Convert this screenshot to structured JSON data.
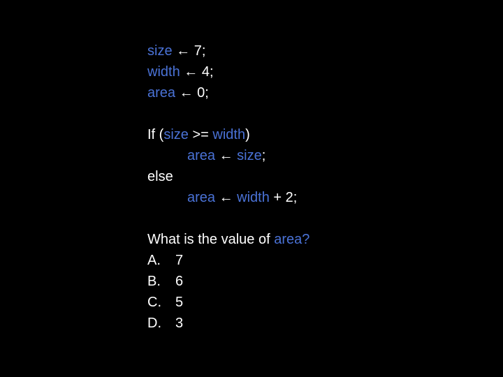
{
  "slide": {
    "colors": {
      "background": "#000000",
      "text": "#ffffff",
      "variable": "#4a72d6"
    },
    "arrow": "←",
    "code": {
      "line1": {
        "var": "size",
        "rest": " 7;"
      },
      "line2": {
        "var": "width",
        "rest": " 4;"
      },
      "line3": {
        "var": "area",
        "rest": " 0;"
      },
      "if_line": {
        "keyword": "If (",
        "var1": "size",
        "op": " >= ",
        "var2": "width",
        "close": ")"
      },
      "then_line": {
        "var1": "area",
        "var2": "size",
        "end": ";"
      },
      "else_keyword": "else",
      "else_line": {
        "var1": "area",
        "var2": "width",
        "rest": " + 2;"
      }
    },
    "question": {
      "text": "What is the value of ",
      "highlight": "area?"
    },
    "options": [
      {
        "letter": "A.",
        "value": "7"
      },
      {
        "letter": "B.",
        "value": "6"
      },
      {
        "letter": "C.",
        "value": "5"
      },
      {
        "letter": "D.",
        "value": "3"
      }
    ]
  }
}
